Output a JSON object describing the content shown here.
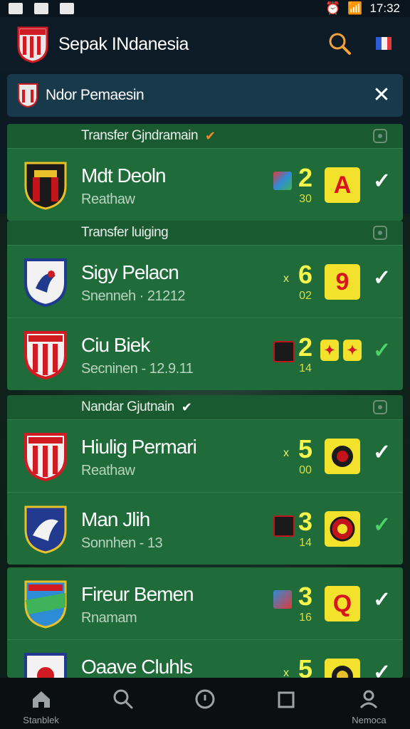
{
  "status_bar": {
    "time": "17:32"
  },
  "app": {
    "title": "Sepak INdanesia"
  },
  "banner": {
    "text": "Ndor Pemaesin"
  },
  "groups": [
    {
      "header": "Transfer Gjndramain",
      "rows": [
        {
          "team": "Mdt Deoln",
          "sub": "Reathaw",
          "score": "2",
          "score_sub": "30",
          "badge": "A",
          "check_color": "#ffffff"
        }
      ]
    },
    {
      "header": "Transfer luiging",
      "rows": [
        {
          "team": "Sigy Pelacn",
          "sub": "Snenneh · 21212",
          "score": "6",
          "score_sub": "02",
          "badge": "9",
          "check_color": "#ffffff"
        },
        {
          "team": "Ciu Biek",
          "sub": "Secninen - 12.9.11",
          "score": "2",
          "score_sub": "14",
          "badge": "",
          "check_color": "#4cd46a"
        }
      ]
    },
    {
      "header": "Nandar Gjutnain",
      "rows": [
        {
          "team": "Hiulig Permari",
          "sub": "Reathaw",
          "score": "5",
          "score_sub": "00",
          "badge": "",
          "check_color": "#ffffff"
        },
        {
          "team": "Man Jlih",
          "sub": "Sonnhen - 13",
          "score": "3",
          "score_sub": "14",
          "badge": "",
          "check_color": "#4cd46a"
        }
      ]
    },
    {
      "header": "",
      "rows": [
        {
          "team": "Fireur Bemen",
          "sub": "Rnamam",
          "score": "3",
          "score_sub": "16",
          "badge": "Q",
          "check_color": "#ffffff"
        },
        {
          "team": "Oaave Cluhls",
          "sub": "",
          "score": "5",
          "score_sub": "",
          "badge": "",
          "check_color": "#ffffff"
        }
      ]
    }
  ],
  "bottom_nav": [
    {
      "label": "Stanblek",
      "icon": "home-icon"
    },
    {
      "label": "",
      "icon": "search-icon"
    },
    {
      "label": "",
      "icon": "circle-icon"
    },
    {
      "label": "",
      "icon": "square-icon"
    },
    {
      "label": "Nemoca",
      "icon": "profile-icon"
    }
  ]
}
